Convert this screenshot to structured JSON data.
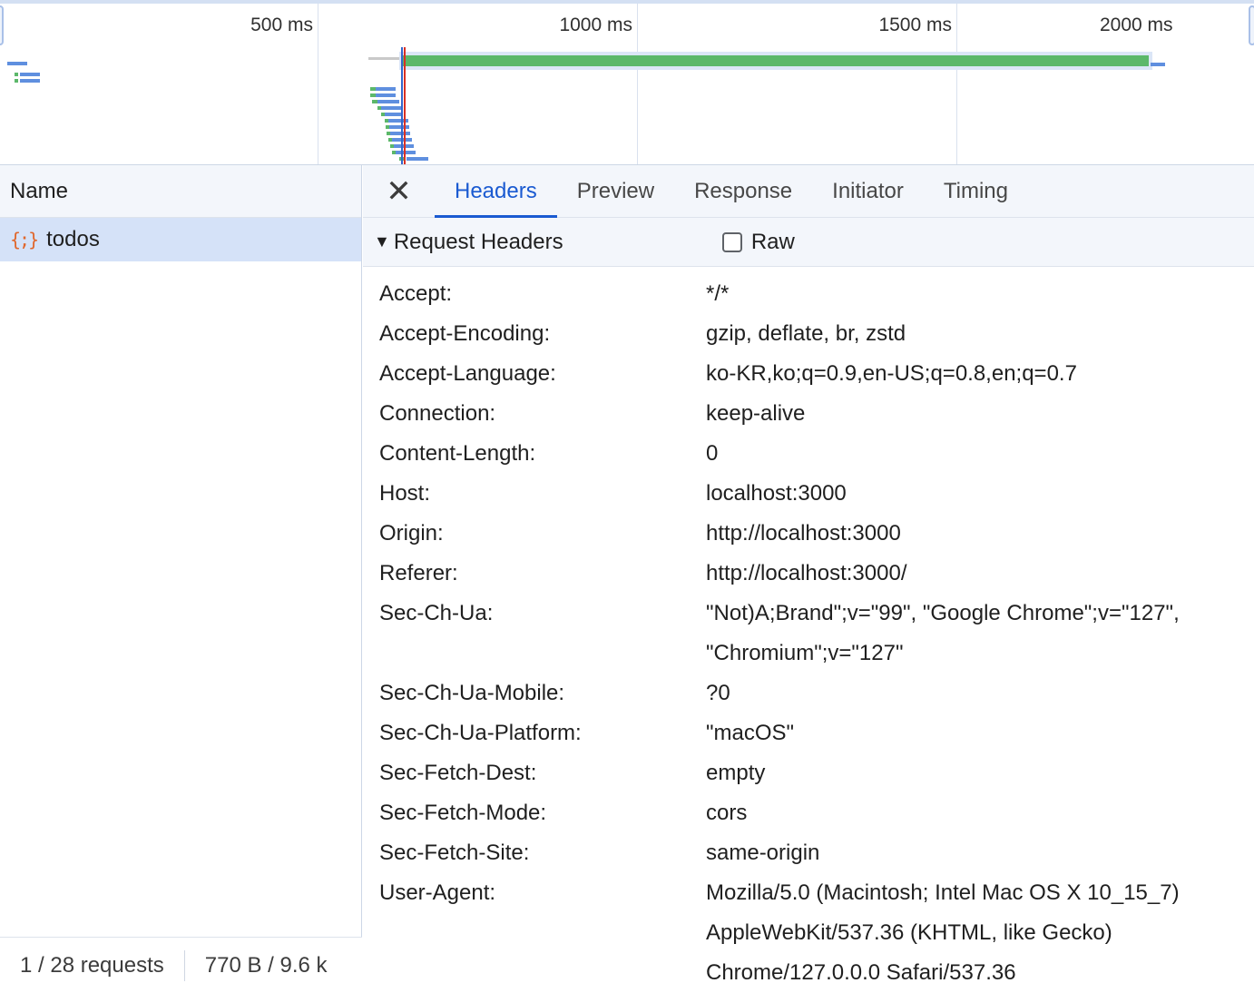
{
  "overview": {
    "ticks": [
      "500 ms",
      "1000 ms",
      "1500 ms",
      "2000 ms"
    ],
    "colors": {
      "waiting": "#5cb86a",
      "download": "#5f8fdf",
      "dom_content_loaded": "#1a5ad1",
      "load": "#d93025"
    }
  },
  "request_list": {
    "column_header": "Name",
    "items": [
      {
        "icon": "json-icon",
        "icon_glyph": "{;}",
        "name": "todos",
        "selected": true
      }
    ],
    "footer": {
      "requests": "1 / 28 requests",
      "transferred": "770 B / 9.6 k"
    }
  },
  "details": {
    "close_glyph": "✕",
    "tabs": [
      {
        "label": "Headers",
        "active": true
      },
      {
        "label": "Preview",
        "active": false
      },
      {
        "label": "Response",
        "active": false
      },
      {
        "label": "Initiator",
        "active": false
      },
      {
        "label": "Timing",
        "active": false
      }
    ],
    "section": {
      "title": "Request Headers",
      "raw_label": "Raw",
      "raw_checked": false
    },
    "headers": [
      {
        "name": "Accept:",
        "value": "*/*"
      },
      {
        "name": "Accept-Encoding:",
        "value": "gzip, deflate, br, zstd"
      },
      {
        "name": "Accept-Language:",
        "value": "ko-KR,ko;q=0.9,en-US;q=0.8,en;q=0.7"
      },
      {
        "name": "Connection:",
        "value": "keep-alive"
      },
      {
        "name": "Content-Length:",
        "value": "0"
      },
      {
        "name": "Host:",
        "value": "localhost:3000"
      },
      {
        "name": "Origin:",
        "value": "http://localhost:3000"
      },
      {
        "name": "Referer:",
        "value": "http://localhost:3000/"
      },
      {
        "name": "Sec-Ch-Ua:",
        "value": "\"Not)A;Brand\";v=\"99\", \"Google Chrome\";v=\"127\", \"Chromium\";v=\"127\""
      },
      {
        "name": "Sec-Ch-Ua-Mobile:",
        "value": "?0"
      },
      {
        "name": "Sec-Ch-Ua-Platform:",
        "value": "\"macOS\""
      },
      {
        "name": "Sec-Fetch-Dest:",
        "value": "empty"
      },
      {
        "name": "Sec-Fetch-Mode:",
        "value": "cors"
      },
      {
        "name": "Sec-Fetch-Site:",
        "value": "same-origin"
      },
      {
        "name": "User-Agent:",
        "value": "Mozilla/5.0 (Macintosh; Intel Mac OS X 10_15_7) AppleWebKit/537.36 (KHTML, like Gecko) Chrome/127.0.0.0 Safari/537.36"
      }
    ]
  }
}
